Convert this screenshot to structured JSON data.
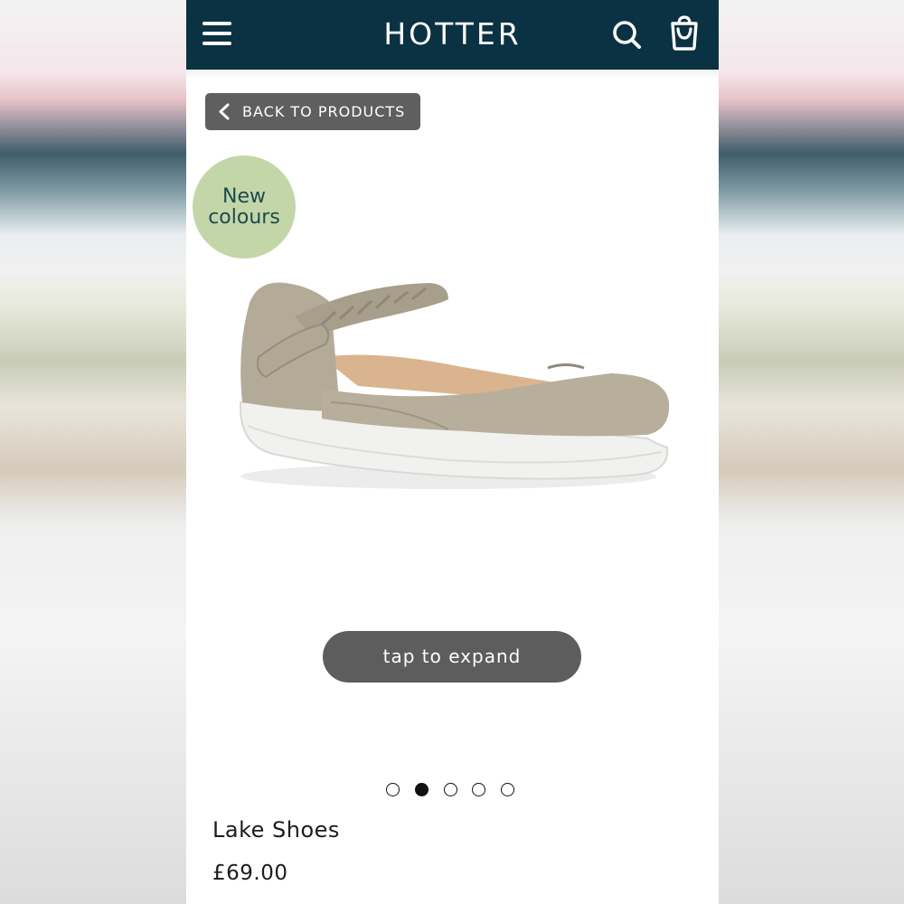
{
  "header": {
    "logo_text": "HOTTER",
    "menu_icon": "hamburger-menu-icon",
    "search_icon": "search-icon",
    "bag_icon": "shopping-bag-icon",
    "background_color": "#0b3242"
  },
  "navigation": {
    "back_label": "BACK TO PRODUCTS",
    "back_icon": "chevron-left-icon"
  },
  "badge": {
    "line1": "New",
    "line2": "colours",
    "color": "#c3d6a8"
  },
  "gallery": {
    "image_subject": "shoe",
    "expand_label": "tap to expand",
    "total_slides": 5,
    "active_slide": 2
  },
  "product": {
    "name": "Lake Shoes",
    "price": "£69.00"
  }
}
